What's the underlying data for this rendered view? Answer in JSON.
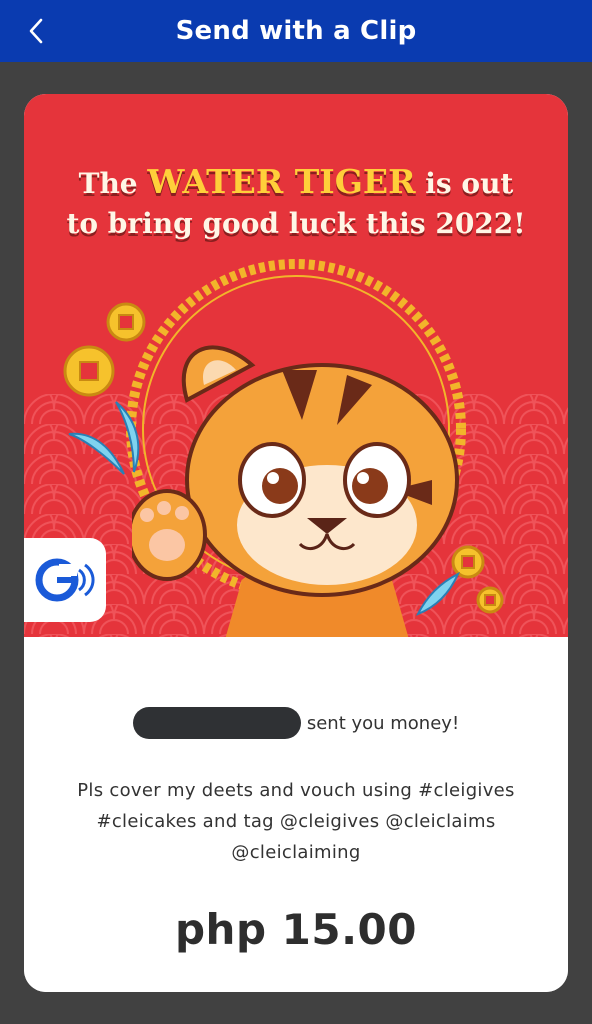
{
  "header": {
    "title": "Send with a Clip",
    "back_icon": "chevron-left-icon"
  },
  "banner": {
    "headline_pre": "The ",
    "headline_accent": "WATER TIGER",
    "headline_post": " is out",
    "headline_line2": "to bring good luck this 2022!",
    "logo_icon": "gcash-logo-icon",
    "background_color": "#e5343b",
    "accent_color": "#ffcf3a"
  },
  "message_card": {
    "sent_text": "sent you money!",
    "message": "Pls cover my deets and vouch using #cleigives #cleicakes and tag @cleigives @cleiclaims @cleiclaiming",
    "amount": "php 15.00"
  },
  "colors": {
    "header_blue": "#0a3bb0",
    "page_background": "#414141"
  }
}
